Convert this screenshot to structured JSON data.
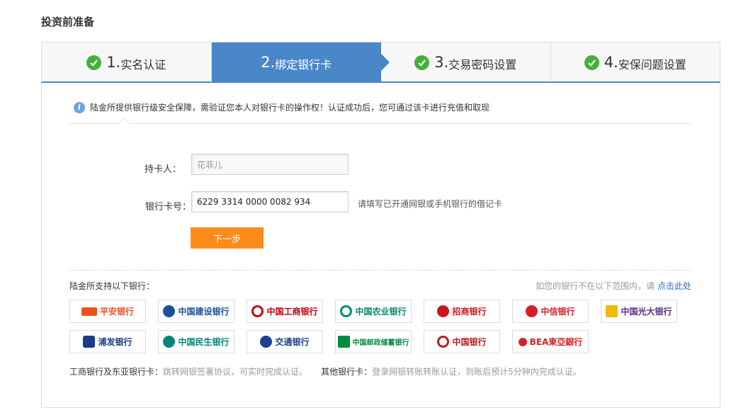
{
  "page_title": "投资前准备",
  "steps": [
    {
      "num": "1.",
      "label": "实名认证",
      "done": true
    },
    {
      "num": "2.",
      "label": "绑定银行卡",
      "done": false
    },
    {
      "num": "3.",
      "label": "交易密码设置",
      "done": true
    },
    {
      "num": "4.",
      "label": "安保问题设置",
      "done": true
    }
  ],
  "notice": "陆金所提供银行级安全保障，需验证您本人对银行卡的操作权！认证成功后，您可通过该卡进行充值和取现",
  "form": {
    "holder_label": "持卡人：",
    "holder_value": "花菲儿",
    "card_label": "银行卡号：",
    "card_value": "6229 3314 0000 0082 934",
    "card_hint": "请填写已开通网银或手机银行的借记卡",
    "next_button": "下一步"
  },
  "banks": {
    "support_label": "陆金所支持以下银行：",
    "not_found_text": "如您的银行不在以下范围内，请",
    "not_found_link": "点击此处",
    "items": [
      {
        "name": "平安银行",
        "color": "#e8531f"
      },
      {
        "name": "中国建设银行",
        "color": "#1b4f9c"
      },
      {
        "name": "中国工商银行",
        "color": "#c7000b"
      },
      {
        "name": "中国农业银行",
        "color": "#008b6e"
      },
      {
        "name": "招商银行",
        "color": "#c8161d"
      },
      {
        "name": "中信银行",
        "color": "#d71e28"
      },
      {
        "name": "中国光大银行",
        "color": "#5b2c86"
      },
      {
        "name": "浦发银行",
        "color": "#1b3a8c"
      },
      {
        "name": "中国民生银行",
        "color": "#00857a"
      },
      {
        "name": "交通银行",
        "color": "#1f3e8c"
      },
      {
        "name": "中国邮政储蓄银行",
        "color": "#008a43"
      },
      {
        "name": "中国银行",
        "color": "#b81c22"
      },
      {
        "name": "BEA東亞銀行",
        "color": "#d2232a"
      }
    ]
  },
  "footnote": {
    "label1": "工商银行及东亚银行卡：",
    "text1": "跳转网银签署协议，可实时完成认证。",
    "label2": "其他银行卡：",
    "text2": "登录网银转账转账认证，到账后预计5分钟内完成认证。"
  }
}
